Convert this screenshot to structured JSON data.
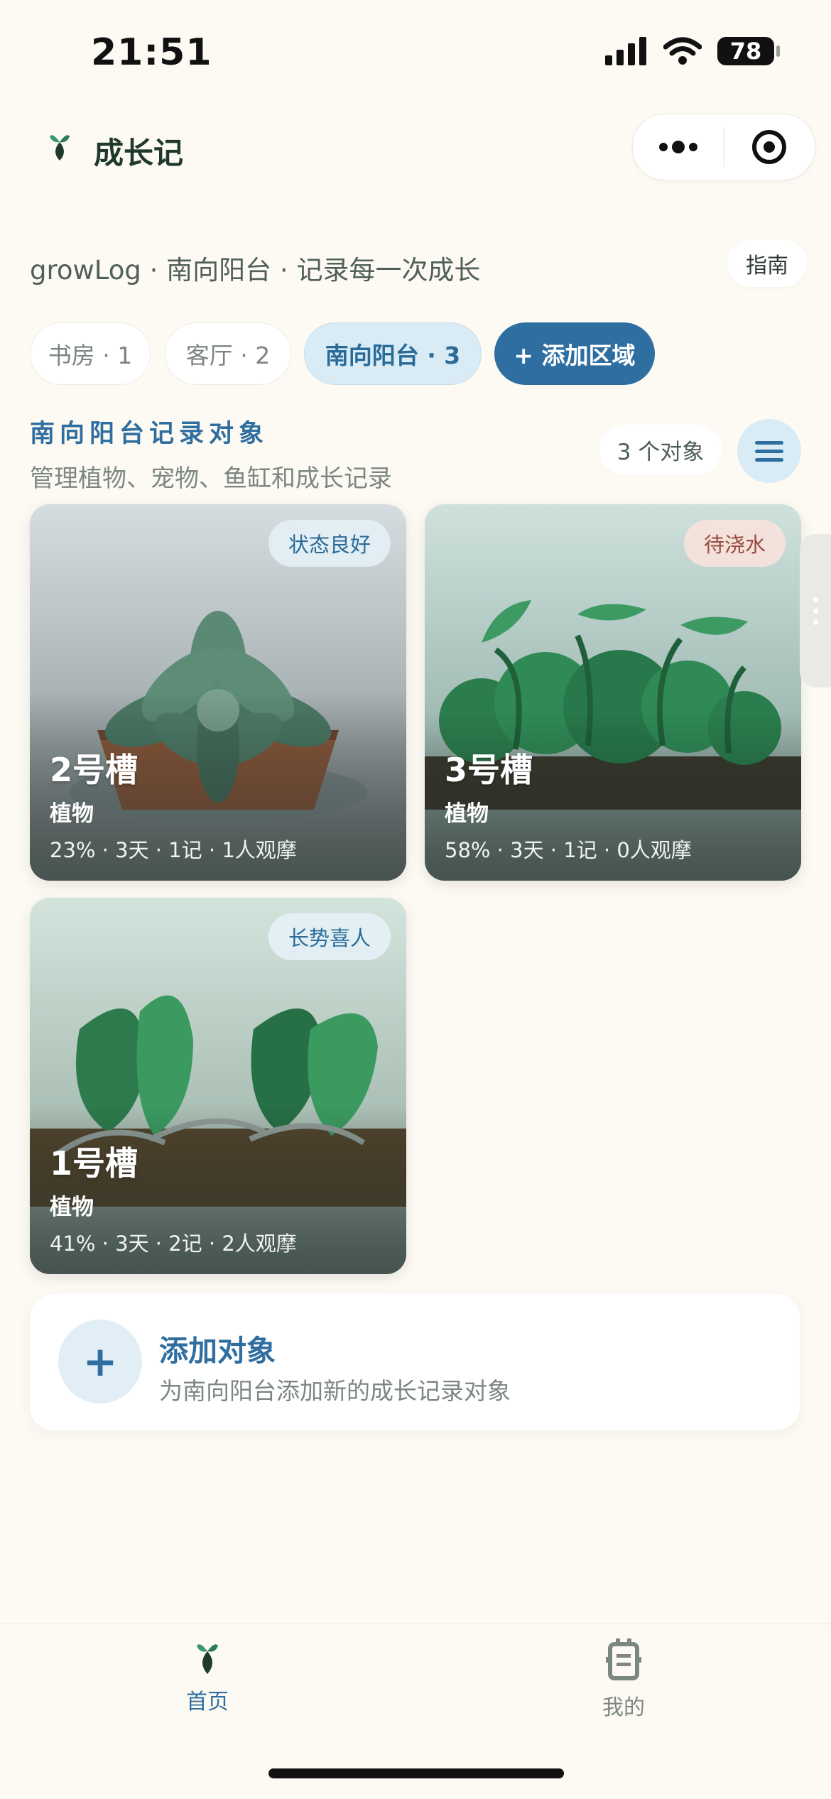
{
  "status_bar": {
    "time": "21:51",
    "battery": "78"
  },
  "header": {
    "title": "成长记",
    "logo_icon": "sprout-icon",
    "more_icon": "more-dots-icon",
    "close_icon": "target-icon"
  },
  "subtitle": "growLog · 南向阳台 · 记录每一次成长",
  "guide_label": "指南",
  "areas": [
    {
      "label": "书房 · 1",
      "active": false
    },
    {
      "label": "客厅 · 2",
      "active": false
    },
    {
      "label": "南向阳台 · 3",
      "active": true
    }
  ],
  "add_area_label": "+ 添加区域",
  "section": {
    "title": "南向阳台记录对象",
    "desc": "管理植物、宠物、鱼缸和成长记录",
    "count": "3 个对象",
    "menu_icon": "menu-icon"
  },
  "cards": [
    {
      "name": "2号槽",
      "type": "植物",
      "meta": "23% · 3天 · 1记 · 1人观摩",
      "badge": "状态良好",
      "badge_tone": "blue"
    },
    {
      "name": "3号槽",
      "type": "植物",
      "meta": "58% · 3天 · 1记 · 0人观摩",
      "badge": "待浇水",
      "badge_tone": "red"
    },
    {
      "name": "1号槽",
      "type": "植物",
      "meta": "41% · 3天 · 2记 · 2人观摩",
      "badge": "长势喜人",
      "badge_tone": "blue"
    }
  ],
  "add_object": {
    "icon": "plus-icon",
    "title": "添加对象",
    "desc": "为南向阳台添加新的成长记录对象"
  },
  "tabbar": {
    "items": [
      {
        "label": "首页",
        "icon": "sprout-icon",
        "active": true
      },
      {
        "label": "我的",
        "icon": "profile-card-icon",
        "active": false
      }
    ]
  },
  "colors": {
    "background": "#fdfaf4",
    "accent": "#2f6ea0",
    "accent_light": "#d9ebf5",
    "dark_green": "#1f3a2c"
  }
}
